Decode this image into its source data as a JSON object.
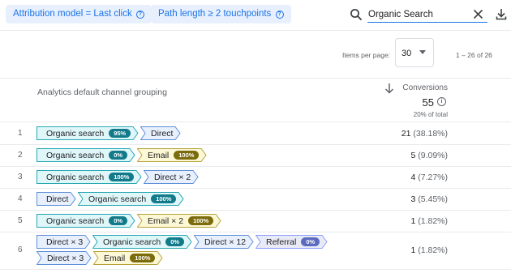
{
  "filters": {
    "attribution_chip": "Attribution model = Last click",
    "path_chip": "Path length ≥ 2 touchpoints",
    "help_glyph": "?"
  },
  "search": {
    "value": "Organic Search"
  },
  "pagination": {
    "label": "Items per page:",
    "value": "30",
    "range": "1 – 26 of 26"
  },
  "header": {
    "dimension": "Analytics default channel grouping",
    "metric": "Conversions",
    "total": "55",
    "total_pct": "20% of total",
    "info_glyph": "i"
  },
  "colors": {
    "teal": "#e0f7fa",
    "teal_border": "#26a6b3",
    "olive": "#fcf8d5",
    "olive_border": "#b5a33a",
    "blue": "#e8f0fe",
    "blue_border": "#5e8ed9",
    "purple": "#e8eaf6",
    "purple_border": "#8c9eff"
  },
  "rows": [
    {
      "num": "1",
      "value": "21",
      "pct": "(38.18%)",
      "lines": [
        [
          {
            "label": "Organic search",
            "badge": "95%",
            "color": "teal"
          },
          {
            "label": "Direct",
            "color": "blue"
          }
        ]
      ]
    },
    {
      "num": "2",
      "value": "5",
      "pct": "(9.09%)",
      "lines": [
        [
          {
            "label": "Organic search",
            "badge": "0%",
            "color": "teal"
          },
          {
            "label": "Email",
            "badge": "100%",
            "color": "olive"
          }
        ]
      ]
    },
    {
      "num": "3",
      "value": "4",
      "pct": "(7.27%)",
      "lines": [
        [
          {
            "label": "Organic search",
            "badge": "100%",
            "color": "teal"
          },
          {
            "label": "Direct × 2",
            "color": "blue"
          }
        ]
      ]
    },
    {
      "num": "4",
      "value": "3",
      "pct": "(5.45%)",
      "lines": [
        [
          {
            "label": "Direct",
            "color": "blue"
          },
          {
            "label": "Organic search",
            "badge": "100%",
            "color": "teal"
          }
        ]
      ]
    },
    {
      "num": "5",
      "value": "1",
      "pct": "(1.82%)",
      "lines": [
        [
          {
            "label": "Organic search",
            "badge": "0%",
            "color": "teal"
          },
          {
            "label": "Email × 2",
            "badge": "100%",
            "color": "olive"
          }
        ]
      ]
    },
    {
      "num": "6",
      "value": "1",
      "pct": "(1.82%)",
      "lines": [
        [
          {
            "label": "Direct × 3",
            "color": "blue"
          },
          {
            "label": "Organic search",
            "badge": "0%",
            "color": "teal"
          },
          {
            "label": "Direct × 12",
            "color": "blue"
          },
          {
            "label": "Referral",
            "badge": "0%",
            "color": "purple"
          }
        ],
        [
          {
            "label": "Direct × 3",
            "color": "blue"
          },
          {
            "label": "Email",
            "badge": "100%",
            "color": "olive"
          }
        ]
      ]
    }
  ]
}
